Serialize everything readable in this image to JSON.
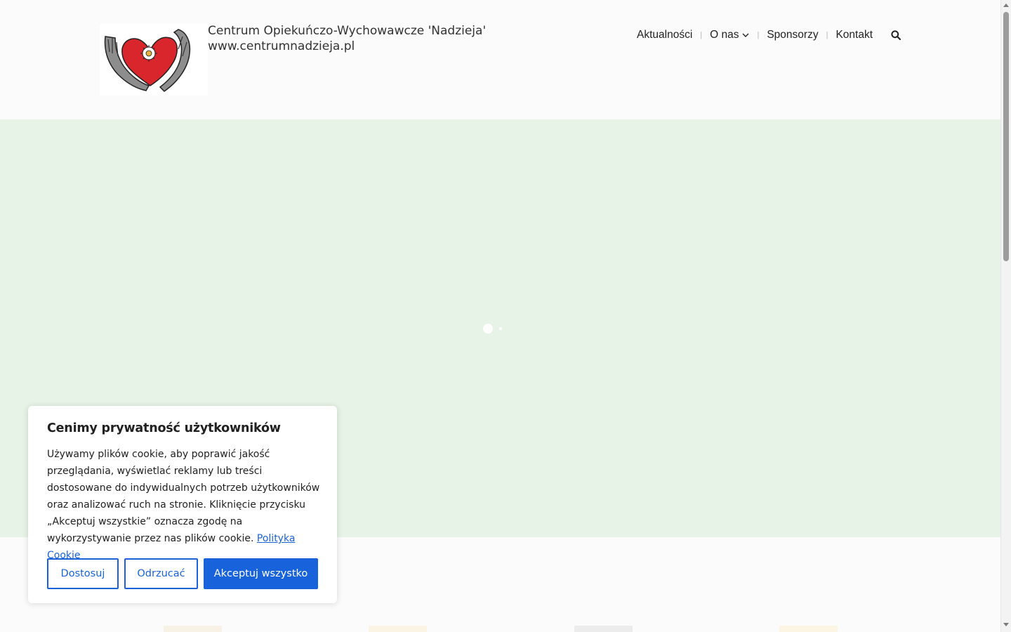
{
  "header": {
    "title_line1": "Centrum Opiekuńczo-Wychowawcze 'Nadzieja'",
    "title_line2": "www.centrumnadzieja.pl",
    "logo_icon": "heart-in-hands-logo"
  },
  "nav": {
    "items": [
      {
        "label": "Aktualności"
      },
      {
        "label": "O nas",
        "has_dropdown": true
      },
      {
        "label": "Sponsorzy"
      },
      {
        "label": "Kontakt"
      }
    ],
    "separator": "|",
    "search_icon": "search-icon"
  },
  "hero": {
    "background": "#e7f3e7"
  },
  "cookie": {
    "title": "Cenimy prywatność użytkowników",
    "text": "Używamy plików cookie, aby poprawić jakość przeglądania, wyświetlać reklamy lub treści dostosowane do indywidualnych potrzeb użytkowników oraz analizować ruch na stronie. Kliknięcie przycisku „Akceptuj wszystkie” oznacza zgodę na wykorzystywanie przez nas plików cookie.",
    "policy_link": "Polityka Cookie",
    "buttons": {
      "customize": "Dostosuj",
      "reject": "Odrzucać",
      "accept": "Akceptuj wszystko"
    },
    "accent_color": "#1863dc"
  }
}
